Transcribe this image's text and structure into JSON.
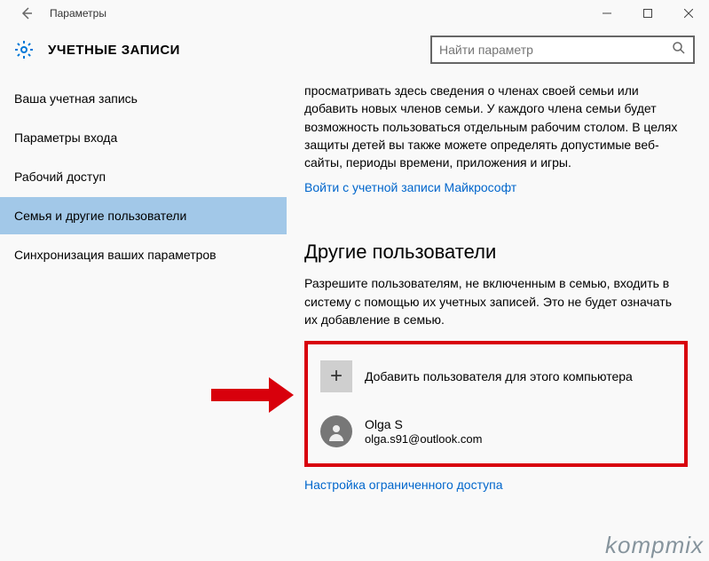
{
  "window": {
    "title": "Параметры"
  },
  "header": {
    "page_title": "УЧЕТНЫЕ ЗАПИСИ",
    "search_placeholder": "Найти параметр"
  },
  "sidebar": {
    "items": [
      {
        "label": "Ваша учетная запись"
      },
      {
        "label": "Параметры входа"
      },
      {
        "label": "Рабочий доступ"
      },
      {
        "label": "Семья и другие пользователи"
      },
      {
        "label": "Синхронизация ваших параметров"
      }
    ],
    "selected_index": 3
  },
  "content": {
    "intro": "просматривать здесь сведения о членах своей семьи или добавить новых членов семьи. У каждого члена семьи будет возможность пользоваться отдельным рабочим столом. В целях защиты детей вы также можете определять допустимые веб-сайты, периоды времени, приложения и игры.",
    "ms_sign_in_link": "Войти с учетной записи Майкрософт",
    "other_users_title": "Другие пользователи",
    "other_users_desc": "Разрешите пользователям, не включенным в семью, входить в систему с помощью их учетных записей. Это не будет означать их добавление в семью.",
    "add_user_label": "Добавить пользователя для этого компьютера",
    "user": {
      "name": "Olga S",
      "email": "olga.s91@outlook.com"
    },
    "restricted_access_link": "Настройка ограниченного доступа"
  },
  "watermark": "kompmix"
}
